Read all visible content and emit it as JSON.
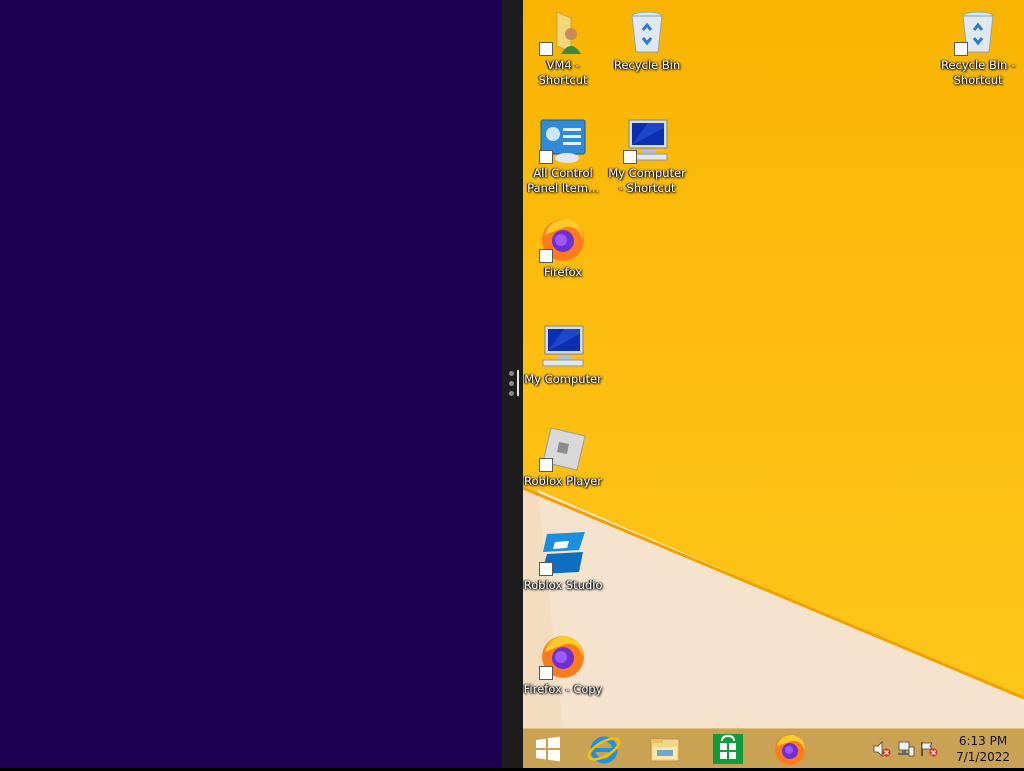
{
  "desktop": {
    "icons": [
      {
        "label": "VM4 - Shortcut"
      },
      {
        "label": "Recycle Bin"
      },
      {
        "label": "Recycle Bin - Shortcut"
      },
      {
        "label": "All Control Panel Item..."
      },
      {
        "label": "My Computer - Shortcut"
      },
      {
        "label": "Firefox"
      },
      {
        "label": "My Computer"
      },
      {
        "label": "Roblox Player"
      },
      {
        "label": "Roblox Studio"
      },
      {
        "label": "Firefox - Copy"
      }
    ]
  },
  "taskbar": {
    "pinned": [
      "start-button",
      "internet-explorer-icon",
      "file-explorer-icon",
      "windows-store-icon",
      "firefox-icon"
    ],
    "tray": [
      "volume-muted-icon",
      "network-icon",
      "action-center-flag-icon"
    ],
    "clock": {
      "time": "6:13 PM",
      "date": "7/1/2022"
    }
  },
  "colors": {
    "left_pane": "#1c0052",
    "desktop_yellow": "#fcbb0d",
    "taskbar": "#caa253"
  }
}
